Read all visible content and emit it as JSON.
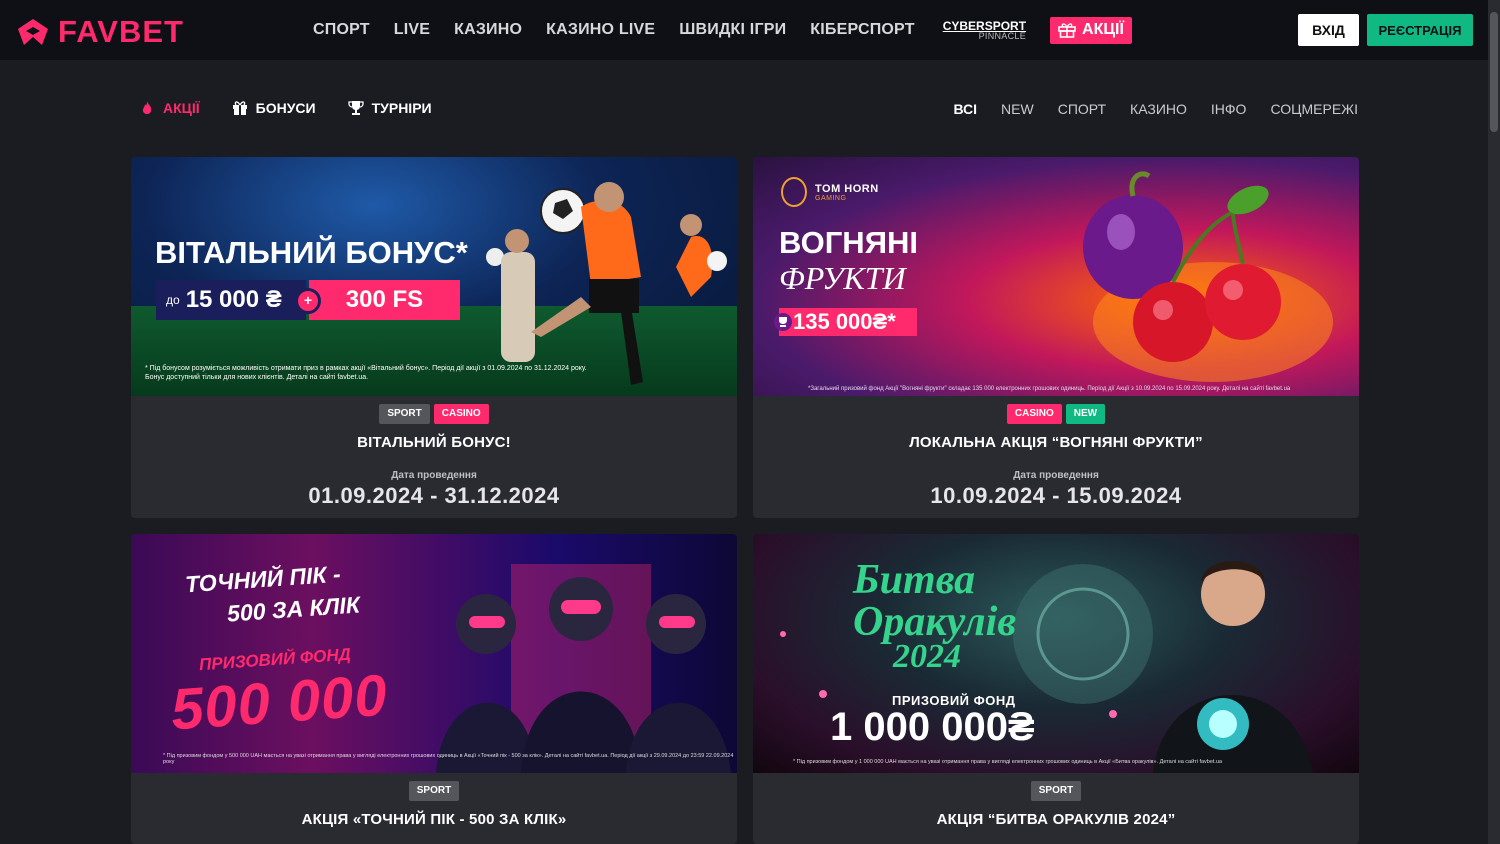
{
  "header": {
    "logo": "FAVBET",
    "nav": [
      "СПОРТ",
      "LIVE",
      "КАЗИНО",
      "КАЗИНО LIVE",
      "ШВИДКІ ІГРИ",
      "КІБЕРСПОРТ"
    ],
    "cybersport_top": "CYBERSPORT",
    "cybersport_bottom": "PINNACLE",
    "promo": "АКЦІЇ",
    "login": "ВХІД",
    "register": "РЕЄСТРАЦІЯ"
  },
  "subnav": {
    "items": [
      "АКЦІЇ",
      "БОНУСИ",
      "ТУРНІРИ"
    ],
    "filters": [
      "ВСІ",
      "NEW",
      "СПОРТ",
      "КАЗИНО",
      "ІНФО",
      "СОЦМЕРЕЖІ"
    ]
  },
  "date_label": "Дата проведення",
  "cards": [
    {
      "tags": [
        "SPORT",
        "CASINO"
      ],
      "title": "ВІТАЛЬНИЙ БОНУС!",
      "date": "01.09.2024 - 31.12.2024",
      "banner": {
        "headline": "ВІТАЛЬНИЙ БОНУС*",
        "offer_prefix": "до",
        "offer_amount": "15 000 ₴",
        "plus": "+",
        "offer_fs": "300 FS",
        "fine1": "* Під бонусом розуміється можливість отримати приз в рамках акції «Вітальний бонус». Період дії акції з 01.09.2024 по 31.12.2024 року.",
        "fine2": "Бонус доступний тільки для нових клієнтів. Деталі на сайті favbet.ua."
      }
    },
    {
      "tags": [
        "CASINO",
        "NEW"
      ],
      "title": "ЛОКАЛЬНА АКЦІЯ “ВОГНЯНІ ФРУКТИ”",
      "date": "10.09.2024 - 15.09.2024",
      "banner": {
        "brand": "TOM HORN",
        "brand_sub": "GAMING",
        "headline1": "ВОГНЯНІ",
        "headline2": "ФРУКТИ",
        "prize": "135 000₴*",
        "fine": "*Загальний призовий фонд Акції \"Вогняні фрукти\" складає 135 000 електронних грошових одиниць. Період дії Акції з 10.09.2024 по 15.09.2024 року. Деталі на сайті favbet.ua"
      }
    },
    {
      "tags": [
        "SPORT"
      ],
      "title": "АКЦІЯ «ТОЧНИЙ ПІК - 500 ЗА КЛІК»",
      "banner": {
        "line1": "ТОЧНИЙ ПІК -",
        "line2": "500 ЗА КЛІК",
        "line3": "ПРИЗОВИЙ ФОНД",
        "amount": "500 000",
        "fine": "* Під призовим фондом у 500 000 UAH мається на увазі отримання права у вигляді електронних грошових одиниць в Акції «Точний пік - 500 за клік». Деталі на сайті favbet.ua. Період дії акції з 29.09.2024 до 23:59 22.09.2024 року"
      }
    },
    {
      "tags": [
        "SPORT"
      ],
      "title": "АКЦІЯ “БИТВА ОРАКУЛІВ 2024”",
      "banner": {
        "t1": "Битва",
        "t2": "Оракулів",
        "t3": "2024",
        "prize_label": "ПРИЗОВИЙ ФОНД",
        "amount": "1 000 000₴",
        "fine": "* Під призовим фондом у 1 000 000 UAH мається на увазі отримання права у вигляді електронних грошових одиниць в Акції «Битва оракулів». Деталі на сайті favbet.ua"
      }
    }
  ],
  "colors": {
    "brand": "#ff2a6d",
    "green": "#10b981",
    "bg": "#1b1c22",
    "card": "#2a2b31"
  }
}
